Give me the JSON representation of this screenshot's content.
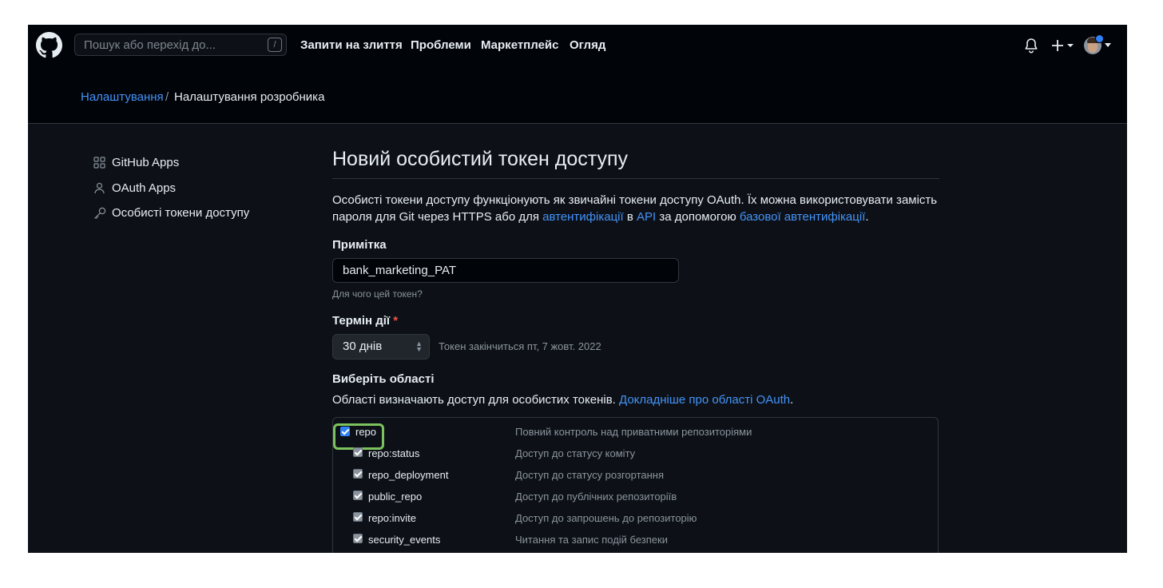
{
  "header": {
    "search_placeholder": "Пошук або перехід до...",
    "search_shortcut": "/",
    "nav": [
      "Запити на злиття",
      "Проблеми",
      "Маркетплейс",
      "Огляд"
    ],
    "icons": [
      "github-logo-icon",
      "bell-icon",
      "plus-icon",
      "avatar"
    ],
    "has_notification": true
  },
  "breadcrumb": {
    "parent": "Налаштування",
    "separator": "/",
    "current": "Налаштування розробника"
  },
  "sidebar": {
    "items": [
      {
        "label": "GitHub Apps",
        "icon": "apps-grid-icon"
      },
      {
        "label": "OAuth Apps",
        "icon": "person-icon"
      },
      {
        "label": "Особисті токени доступу",
        "icon": "key-icon"
      }
    ]
  },
  "form": {
    "title": "Новий особистий токен доступу",
    "description": {
      "part1": "Особисті токени доступу функціонують як звичайні токени доступу OAuth. Їх можна використовувати замість пароля для Git через HTTPS або для ",
      "link1": "автентифікації",
      "part2": " в ",
      "link2": "API",
      "part3": " за допомогою ",
      "link3": "базової автентифікації",
      "part4": "."
    },
    "note_label": "Примітка",
    "note_value": "bank_marketing_PAT",
    "note_hint": "Для чого цей токен?",
    "expiry_label": "Термін дії",
    "required_mark": "*",
    "expiry_value": "30 днів",
    "expiry_note": "Токен закінчиться пт, 7 жовт. 2022",
    "scopes_label": "Виберіть області",
    "scopes_desc": "Області визначають доступ для особистих токенів.",
    "scopes_link": "Докладніше про області OAuth",
    "scopes_desc_end": ".",
    "scopes": [
      {
        "name": "repo",
        "desc": "Повний контроль над приватними репозиторіями",
        "checked": true
      },
      {
        "name": "repo:status",
        "desc": "Доступ до статусу коміту",
        "checked": true
      },
      {
        "name": "repo_deployment",
        "desc": "Доступ до статусу розгортання",
        "checked": true
      },
      {
        "name": "public_repo",
        "desc": "Доступ до публічних репозиторіїв",
        "checked": true
      },
      {
        "name": "repo:invite",
        "desc": "Доступ до запрошень до репозиторію",
        "checked": true
      },
      {
        "name": "security_events",
        "desc": "Читання та запис подій безпеки",
        "checked": true
      }
    ]
  },
  "colors": {
    "background": "#0d1117",
    "header": "#010409",
    "link": "#4493f8",
    "required": "#f85149",
    "highlight": "#7cc25e",
    "checkbox_parent": "#2f81f7"
  }
}
